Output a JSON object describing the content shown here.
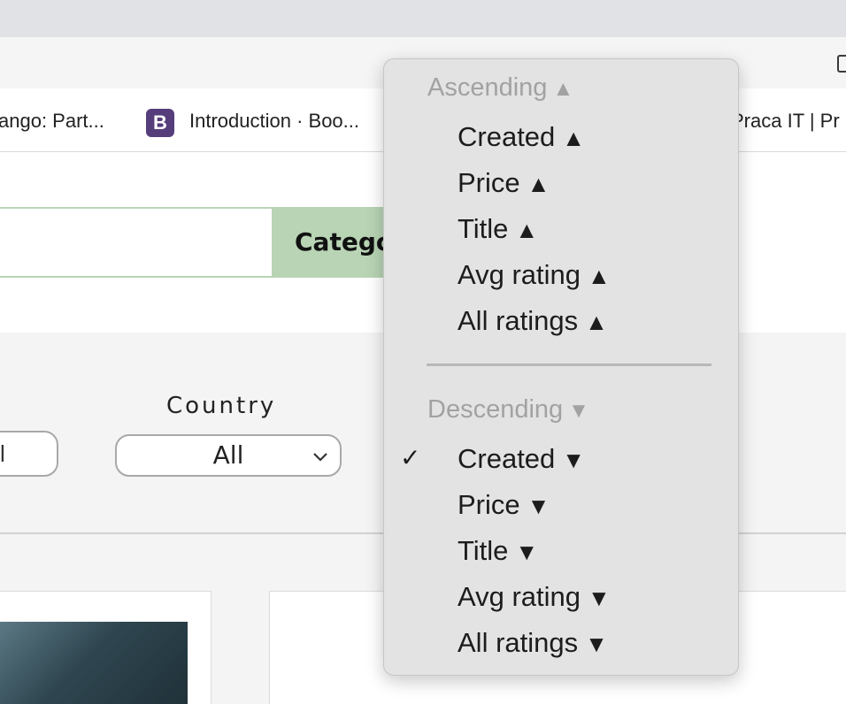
{
  "bookmarks": {
    "django_label": "ango: Part...",
    "bootstrap_icon": "B",
    "bootstrap_label": "Introduction · Boo...",
    "praca_label": "Praca IT | Pr"
  },
  "header": {
    "category_button_label": "Catego"
  },
  "filters": {
    "left_select_value": "l",
    "country_label": "Country",
    "country_value": "All"
  },
  "sort_menu": {
    "ascending_header": "Ascending",
    "descending_header": "Descending",
    "up_arrow": "▲",
    "down_arrow": "▼",
    "checkmark": "✓",
    "ascending_items": [
      {
        "label": "Created"
      },
      {
        "label": "Price"
      },
      {
        "label": "Title"
      },
      {
        "label": "Avg rating"
      },
      {
        "label": "All ratings"
      }
    ],
    "descending_items": [
      {
        "label": "Created",
        "selected": true
      },
      {
        "label": "Price"
      },
      {
        "label": "Title"
      },
      {
        "label": "Avg rating"
      },
      {
        "label": "All ratings"
      }
    ]
  }
}
